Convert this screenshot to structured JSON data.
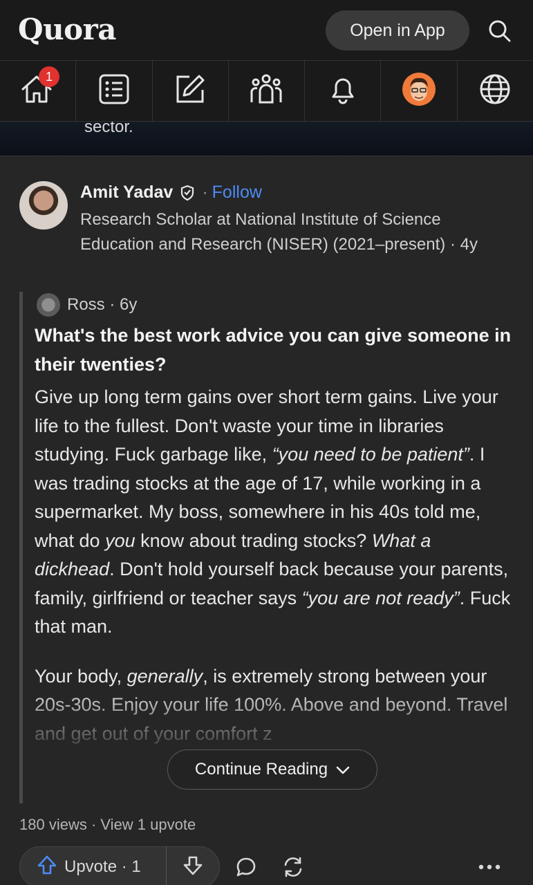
{
  "header": {
    "logo": "Quora",
    "open_app_label": "Open in App"
  },
  "nav": {
    "notification_count": "1",
    "items": [
      "home-icon",
      "answer-list-icon",
      "edit-icon",
      "spaces-icon",
      "bell-icon",
      "profile-avatar",
      "globe-icon"
    ]
  },
  "previous_card": {
    "text_fragment": "sector."
  },
  "post": {
    "author": "Amit Yadav",
    "separator": "·",
    "follow_label": "Follow",
    "credential": "Research Scholar at National Institute of Science Education and Research (NISER) (2021–present) · 4y",
    "quoted": {
      "author": "Ross · 6y",
      "question": "What's the best work advice you can give someone in their twenties?",
      "answer_p1": {
        "t1": "Give up long term gains over short term gains. Live your life to the fullest. Don't waste your time in libraries studying. Fuck garbage like, ",
        "i1": "“you need to be patient”",
        "t2": ". I was trading stocks at the age of 17, while working in a supermarket. My boss, somewhere in his 40s told me, what do ",
        "i2": "you",
        "t3": " know about trading stocks? ",
        "i3": "What a dickhead",
        "t4": ". Don't hold yourself back because your parents, family, girlfriend or teacher says ",
        "i4": "“you are not ready”",
        "t5": ". Fuck that man."
      },
      "answer_p2": {
        "t1": "Your body, ",
        "i1": "generally",
        "t2": ", is extremely strong between your 20s-30s. Enjoy your life 100%. Above and beyond. Travel and get out of your comfort z"
      }
    },
    "continue_label": "Continue Reading",
    "views": "180 views",
    "stats_separator": " · ",
    "upvotes_link": "View 1 upvote",
    "upvote_label": "Upvote · 1"
  },
  "colors": {
    "background": "#262626",
    "header": "#1a1a1a",
    "accent_blue": "#4c8bf5",
    "badge_red": "#e0322f"
  }
}
